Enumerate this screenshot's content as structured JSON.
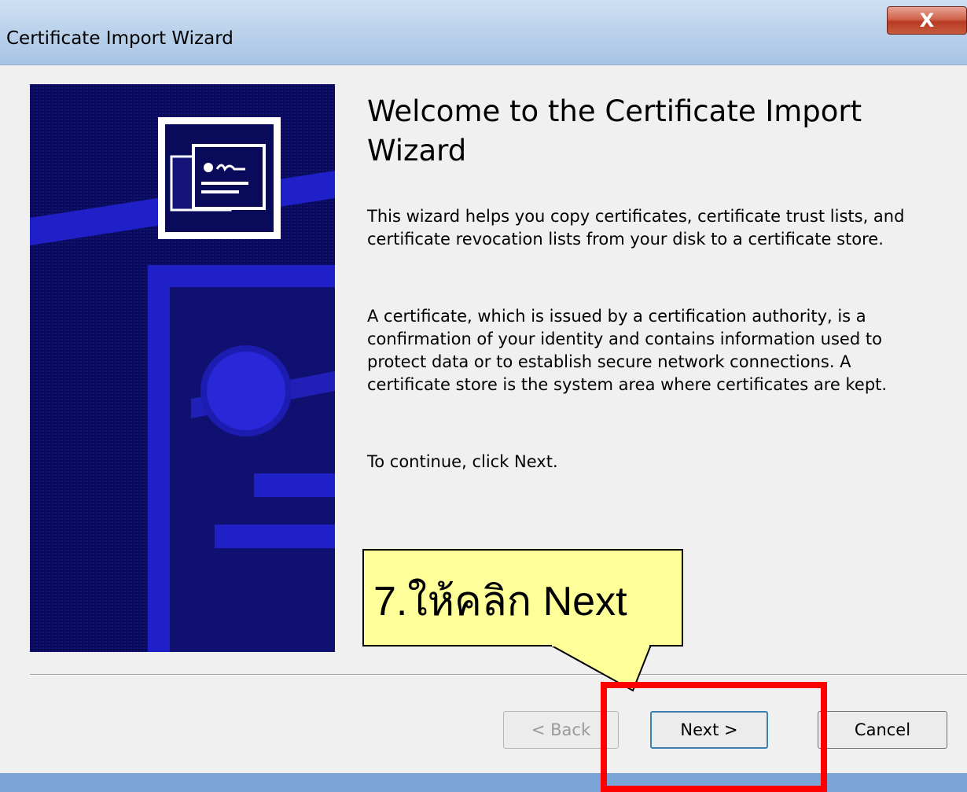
{
  "window": {
    "title": "Certificate Import Wizard",
    "close_glyph": "X"
  },
  "content": {
    "heading": "Welcome to the Certificate Import Wizard",
    "para1": "This wizard helps you copy certificates, certificate trust lists, and certificate revocation lists from your disk to a certificate store.",
    "para2": "A certificate, which is issued by a certification authority, is a confirmation of your identity and contains information used to protect data or to establish secure network connections. A certificate store is the system area where certificates are kept.",
    "para3": "To continue, click Next."
  },
  "buttons": {
    "back": "< Back",
    "next": "Next >",
    "cancel": "Cancel"
  },
  "annotation": {
    "callout_text": "7.ให้คลิก Next",
    "callout_color": "#ffff99",
    "highlight_color": "#ff0000"
  },
  "icons": {
    "close": "close-icon",
    "certificate": "certificate-icon",
    "seal": "seal-icon"
  }
}
